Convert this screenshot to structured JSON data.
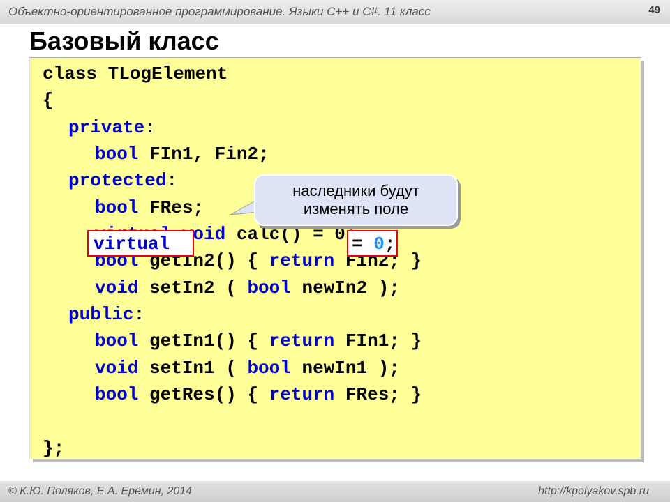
{
  "header": {
    "course": "Объектно-ориентированное программирование. Языки C++ и C#. 11 класс",
    "slide_number": "49"
  },
  "title": "Базовый класс",
  "code": {
    "line1_kw": "class",
    "line1_rest": " TLogElement",
    "line2": "{",
    "line3_kw": "private",
    "line3_rest": ":",
    "line4_kw": "bool",
    "line4_rest": " FIn1, Fin2;",
    "line5_kw": "protected",
    "line5_rest": ":",
    "line6_kw": "bool",
    "line6_rest": " FRes;",
    "line7_kw1": "virtual",
    "line7_kw2": "void",
    "line7_rest": " calc() = 0;",
    "line8_kw": "bool",
    "line8_mid": " getIn2() { ",
    "line8_kw2": "return",
    "line8_rest": " Fin2; }",
    "line9_kw": "void",
    "line9_mid": " setIn2 ( ",
    "line9_kw2": "bool",
    "line9_rest": " newIn2 );",
    "line10_kw": "public",
    "line10_rest": ":",
    "line11_kw": "bool",
    "line11_mid": " getIn1() { ",
    "line11_kw2": "return",
    "line11_rest": " FIn1; }",
    "line12_kw": "void",
    "line12_mid": " setIn1 ( ",
    "line12_kw2": "bool",
    "line12_rest": " newIn1 );",
    "line13_kw": "bool",
    "line13_mid": " getRes() { ",
    "line13_kw2": "return",
    "line13_rest": " FRes; }",
    "line14": "};"
  },
  "callout": {
    "line1": "наследники будут",
    "line2": "изменять поле"
  },
  "overlays": {
    "virtual_label": "virtual",
    "eq": "= ",
    "zero": "0",
    "semicolon": ";"
  },
  "footer": {
    "authors": "© К.Ю. Поляков, Е.А. Ерёмин, 2014",
    "url": "http://kpolyakov.spb.ru"
  },
  "colors": {
    "keyword": "#0000cc",
    "code_background": "#ffff99",
    "callout_background": "#dde4f5",
    "highlight_border": "#e0001b",
    "zero": "#1e90ff"
  }
}
